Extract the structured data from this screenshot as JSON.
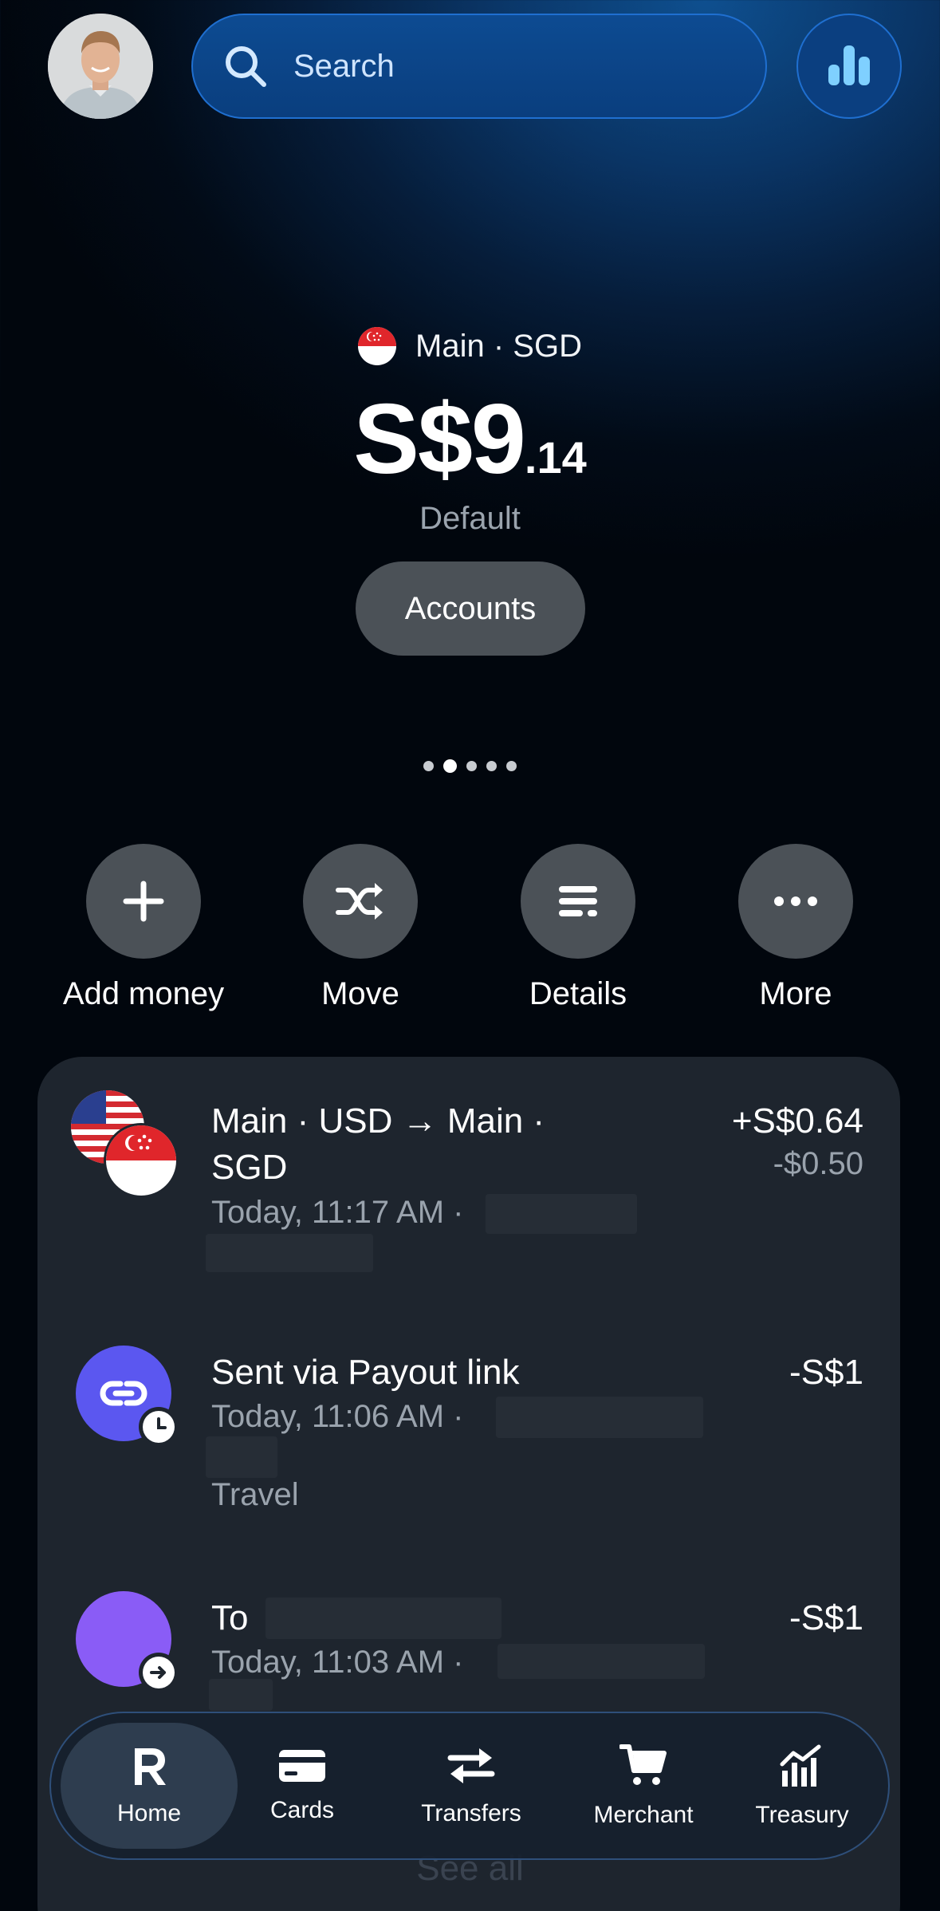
{
  "header": {
    "search_placeholder": "Search"
  },
  "balance": {
    "account_label": "Main · SGD",
    "amount_main": "S$9",
    "amount_cents": ".14",
    "status": "Default",
    "accounts_button": "Accounts"
  },
  "pager": {
    "count": 5,
    "active_index": 1
  },
  "actions": [
    {
      "label": "Add money",
      "icon": "plus-icon"
    },
    {
      "label": "Move",
      "icon": "shuffle-icon"
    },
    {
      "label": "Details",
      "icon": "details-icon"
    },
    {
      "label": "More",
      "icon": "more-icon"
    }
  ],
  "transactions": [
    {
      "title_line1": "Main · USD → Main ·",
      "title_line2": "SGD",
      "subtitle": "Today, 11:17 AM ·",
      "amount": "+S$0.64",
      "amount_secondary": "-$0.50",
      "icon": "usd-sgd-flags-icon"
    },
    {
      "title": "Sent via Payout link",
      "subtitle": "Today, 11:06 AM ·",
      "category": "Travel",
      "amount": "-S$1",
      "icon": "payout-link-icon"
    },
    {
      "title": "To",
      "subtitle": "Today, 11:03 AM ·",
      "amount": "-S$1",
      "icon": "recipient-avatar-icon"
    }
  ],
  "see_all": "See all",
  "nav": [
    {
      "label": "Home",
      "icon": "revolut-r-icon",
      "active": true
    },
    {
      "label": "Cards",
      "icon": "card-icon"
    },
    {
      "label": "Transfers",
      "icon": "transfers-icon"
    },
    {
      "label": "Merchant",
      "icon": "cart-icon"
    },
    {
      "label": "Treasury",
      "icon": "treasury-chart-icon"
    }
  ],
  "colors": {
    "accent_blue": "#1f6fd0",
    "payout_purple": "#5b57f0",
    "recipient_purple": "#8a5cf6",
    "button_gray": "#4b5157",
    "card_bg": "#1e252e"
  }
}
